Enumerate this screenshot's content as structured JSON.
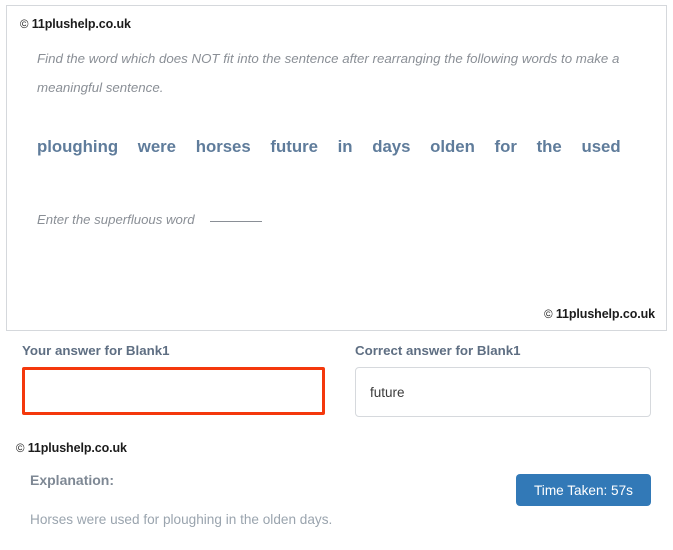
{
  "question_card": {
    "copyright_top": "11plushelp.co.uk",
    "copyright_symbol": "©",
    "instruction": "Find the word which does NOT fit into the sentence after rearranging the following words to make a meaningful sentence.",
    "words": [
      "ploughing",
      "were",
      "horses",
      "future",
      "in",
      "days",
      "olden",
      "for",
      "the",
      "used"
    ],
    "superfluous_prompt": "Enter the superfluous word",
    "copyright_bottom": "11plushelp.co.uk"
  },
  "answers": {
    "your_answer_label": "Your answer for Blank1",
    "your_answer_value": "",
    "correct_answer_label": "Correct answer for Blank1",
    "correct_answer_value": "future"
  },
  "explanation": {
    "copyright": "11plushelp.co.uk",
    "title": "Explanation:",
    "text": "Horses were used for ploughing in the olden days."
  },
  "time": {
    "badge_label": "Time Taken: 57s"
  },
  "colors": {
    "wrong_answer_border": "#f4380c",
    "badge_background": "#3279b7",
    "word_text": "#5f7c9b",
    "label_text": "#5e6e82",
    "muted_text": "#9aa4ae",
    "card_border": "#d5d8dc"
  }
}
